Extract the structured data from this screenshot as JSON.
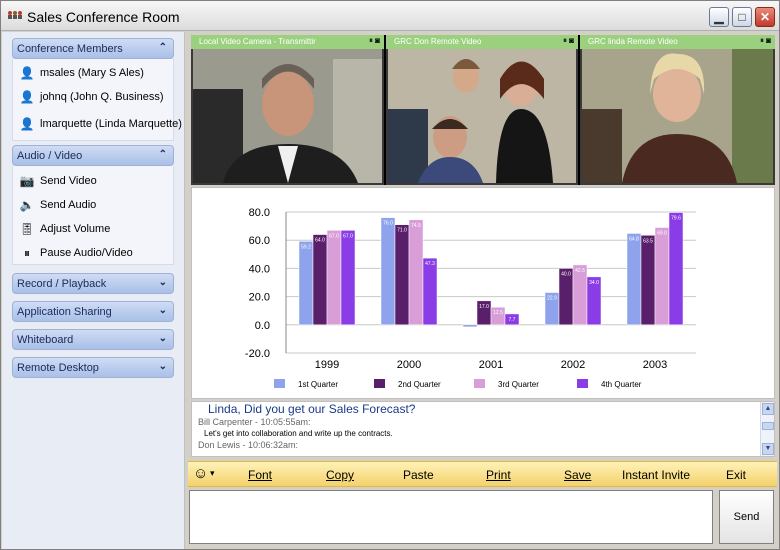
{
  "window": {
    "title": "Sales Conference Room"
  },
  "sidebar": {
    "members": {
      "title": "Conference Members",
      "items": [
        {
          "label": "msales (Mary S Ales)",
          "icon": "user-icon"
        },
        {
          "label": "johnq (John Q. Business)",
          "icon": "user-icon"
        },
        {
          "label": "lmarquette (Linda Marquette)",
          "icon": "user-icon"
        }
      ]
    },
    "av": {
      "title": "Audio / Video",
      "items": [
        {
          "label": "Send Video",
          "icon": "camera-icon"
        },
        {
          "label": "Send Audio",
          "icon": "speaker-icon"
        },
        {
          "label": "Adjust Volume",
          "icon": "volume-slider-icon"
        },
        {
          "label": "Pause Audio/Video",
          "icon": "pause-icon"
        }
      ]
    },
    "record": {
      "title": "Record / Playback"
    },
    "app_sharing": {
      "title": "Application Sharing"
    },
    "whiteboard": {
      "title": "Whiteboard"
    },
    "remote": {
      "title": "Remote Desktop"
    }
  },
  "video": {
    "panes": [
      {
        "label": "Local Video Camera - Transmittir"
      },
      {
        "label": "GRC Don Remote Video"
      },
      {
        "label": "GRC linda Remote Video"
      }
    ]
  },
  "chat": {
    "headline": "Linda, Did you get our Sales Forecast?",
    "line1_meta": "Bill Carpenter - 10:05:55am:",
    "line1_text": "Let's get into collaboration and write up the contracts.",
    "line2_meta": "Don Lewis - 10:06:32am:"
  },
  "toolbar": {
    "font": "Font",
    "copy": "Copy",
    "paste": "Paste",
    "print": "Print",
    "save": "Save",
    "invite": "Instant Invite",
    "exit": "Exit"
  },
  "send_label": "Send",
  "colors": {
    "q1": "#8ea3ec",
    "q2": "#5a1f6a",
    "q3": "#d99ed8",
    "q4": "#8a3ce6"
  },
  "chart_data": {
    "type": "bar",
    "categories": [
      "1999",
      "2000",
      "2001",
      "2002",
      "2003"
    ],
    "series": [
      {
        "name": "1st Quarter",
        "values": [
          59.2,
          76.0,
          -1.5,
          22.9,
          64.8
        ]
      },
      {
        "name": "2nd Quarter",
        "values": [
          64.0,
          71.0,
          17.0,
          40.0,
          63.5
        ]
      },
      {
        "name": "3rd Quarter",
        "values": [
          67.0,
          74.5,
          12.5,
          42.5,
          69.0
        ]
      },
      {
        "name": "4th Quarter",
        "values": [
          67.0,
          47.3,
          7.7,
          34.0,
          79.6
        ]
      }
    ],
    "y_ticks": [
      "80.0",
      "60.0",
      "40.0",
      "20.0",
      "0.0",
      "-20.0"
    ],
    "ylim": [
      -20,
      80
    ],
    "grid": "horizontal",
    "legend": "bottom"
  }
}
